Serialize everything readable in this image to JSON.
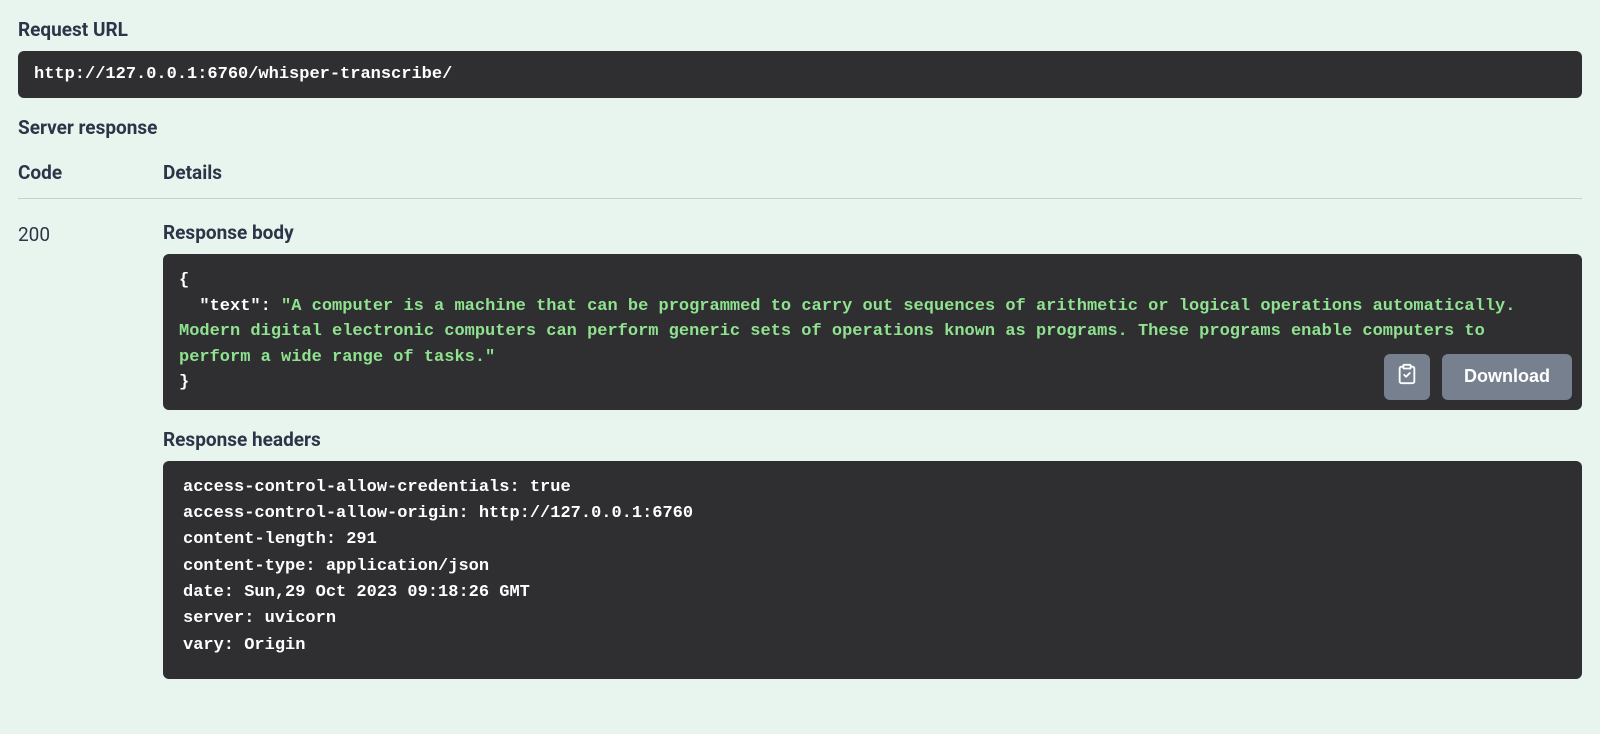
{
  "labels": {
    "request_url": "Request URL",
    "server_response": "Server response",
    "code": "Code",
    "details": "Details",
    "response_body": "Response body",
    "response_headers": "Response headers",
    "download": "Download"
  },
  "request": {
    "url": "http://127.0.0.1:6760/whisper-transcribe/"
  },
  "response": {
    "status_code": "200",
    "body_json": {
      "key": "\"text\"",
      "value": "\"A computer is a machine that can be programmed to carry out sequences of arithmetic or logical operations automatically. Modern digital electronic computers can perform generic sets of operations known as programs. These programs enable computers to perform a wide range of tasks.\""
    },
    "headers": [
      " access-control-allow-credentials: true ",
      " access-control-allow-origin: http://127.0.0.1:6760 ",
      " content-length: 291 ",
      " content-type: application/json ",
      " date: Sun,29 Oct 2023 09:18:26 GMT ",
      " server: uvicorn ",
      " vary: Origin "
    ]
  }
}
